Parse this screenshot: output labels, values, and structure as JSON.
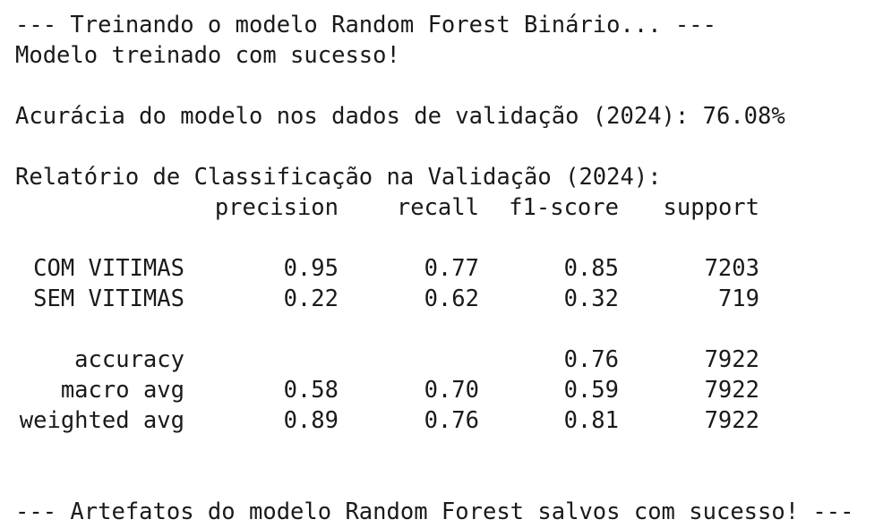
{
  "output": {
    "training_msg": "--- Treinando o modelo Random Forest Binário... ---",
    "trained_msg": "Modelo treinado com sucesso!",
    "accuracy_msg": "Acurácia do modelo nos dados de validação (2024): 76.08%",
    "report_title": "Relatório de Classificação na Validação (2024):",
    "saved_msg": "--- Artefatos do modelo Random Forest salvos com sucesso! ---"
  },
  "report": {
    "headers": {
      "precision": "precision",
      "recall": "recall",
      "f1": "f1-score",
      "support": "support"
    },
    "classes": [
      {
        "label": "COM VITIMAS",
        "precision": "0.95",
        "recall": "0.77",
        "f1": "0.85",
        "support": "7203"
      },
      {
        "label": "SEM VITIMAS",
        "precision": "0.22",
        "recall": "0.62",
        "f1": "0.32",
        "support": "719"
      }
    ],
    "summary": [
      {
        "label": "accuracy",
        "precision": "",
        "recall": "",
        "f1": "0.76",
        "support": "7922"
      },
      {
        "label": "macro avg",
        "precision": "0.58",
        "recall": "0.70",
        "f1": "0.59",
        "support": "7922"
      },
      {
        "label": "weighted avg",
        "precision": "0.89",
        "recall": "0.76",
        "f1": "0.81",
        "support": "7922"
      }
    ]
  }
}
